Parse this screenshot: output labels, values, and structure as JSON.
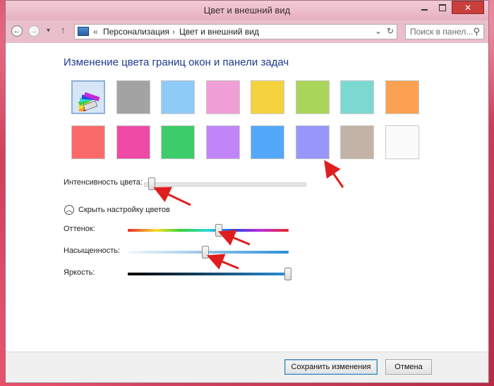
{
  "window": {
    "title": "Цвет и внешний вид"
  },
  "navigation": {
    "breadcrumb_sep": "«",
    "breadcrumb_parent": "Персонализация",
    "breadcrumb_arrow": "›",
    "breadcrumb_current": "Цвет и внешний вид",
    "search_placeholder": "Поиск в панел..."
  },
  "main": {
    "heading": "Изменение цвета границ окон и панели задач",
    "swatches": [
      {
        "color": "custom-palette",
        "selected": true
      },
      {
        "color": "#a3a3a3"
      },
      {
        "color": "#8ecbf6"
      },
      {
        "color": "#f09ed6"
      },
      {
        "color": "#f5d33f"
      },
      {
        "color": "#a9d65a"
      },
      {
        "color": "#7cd9d2"
      },
      {
        "color": "#fba151"
      },
      {
        "color": "#fb6a6a"
      },
      {
        "color": "#ef4ba6"
      },
      {
        "color": "#3dcc6a"
      },
      {
        "color": "#c285f9"
      },
      {
        "color": "#53a8f9"
      },
      {
        "color": "#9696fb"
      },
      {
        "color": "#c2b3a6"
      },
      {
        "color": "#fbfbfb"
      }
    ],
    "intensity_label": "Интенсивность цвета:",
    "intensity_value": 0.02,
    "toggle_label": "Скрыть настройку цветов",
    "hue_label": "Оттенок:",
    "hue_value": 0.57,
    "saturation_label": "Насыщенность:",
    "saturation_value": 0.48,
    "brightness_label": "Яркость:",
    "brightness_value": 1.0
  },
  "footer": {
    "save_label": "Сохранить изменения",
    "cancel_label": "Отмена"
  },
  "colors": {
    "heading": "#1e3a8c",
    "annotation_arrow": "#e01e1e",
    "window_frame": "#e7b8c5"
  }
}
